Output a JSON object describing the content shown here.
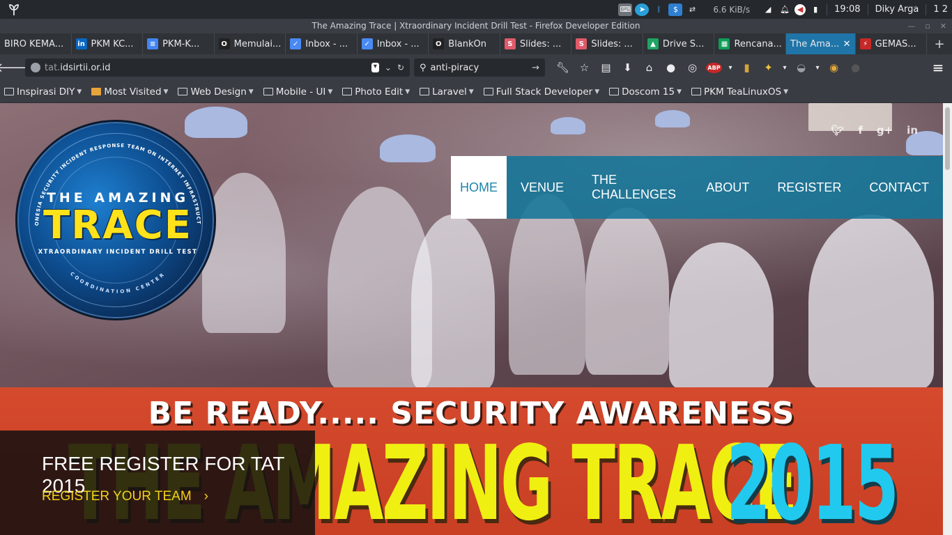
{
  "system": {
    "net_speed": "6.6 KiB/s",
    "clock": "19:08",
    "user": "Diky Arga",
    "workspaces": "1 2"
  },
  "window": {
    "title": "The Amazing Trace | Xtraordinary Incident Drill Test - Firefox Developer Edition"
  },
  "tabs": [
    {
      "label": "BIRO KEMA...",
      "icon": "none"
    },
    {
      "label": "PKM KC...",
      "icon": "linkedin-icon",
      "color": "#0a66c2",
      "glyph": "in"
    },
    {
      "label": "PKM-K...",
      "icon": "docs-icon",
      "color": "#4285f4",
      "glyph": "≡"
    },
    {
      "label": "Memulai...",
      "icon": "opera-icon",
      "color": "#222",
      "glyph": "O"
    },
    {
      "label": "Inbox - ...",
      "icon": "inbox-icon",
      "color": "#4a8af4",
      "glyph": "✓"
    },
    {
      "label": "Inbox - ...",
      "icon": "inbox-icon",
      "color": "#4a8af4",
      "glyph": "✓"
    },
    {
      "label": "BlankOn",
      "icon": "opera-icon",
      "color": "#222",
      "glyph": "O"
    },
    {
      "label": "Slides: ...",
      "icon": "slides-icon",
      "color": "#e05a6a",
      "glyph": "S"
    },
    {
      "label": "Slides: ...",
      "icon": "slides-icon",
      "color": "#e05a6a",
      "glyph": "S"
    },
    {
      "label": "Drive S...",
      "icon": "drive-icon",
      "color": "#1fa463",
      "glyph": "▲"
    },
    {
      "label": "Rencana...",
      "icon": "sheets-icon",
      "color": "#0f9d58",
      "glyph": "▦"
    },
    {
      "label": "The Ama...",
      "icon": "none",
      "active": true
    },
    {
      "label": "GEMAS...",
      "icon": "gemas-icon",
      "color": "#c62828",
      "glyph": "⚡"
    }
  ],
  "nav": {
    "url_dim": "tat.",
    "url_host": "idsirtii.or.id",
    "search_value": "anti-piracy"
  },
  "bookmarks": [
    {
      "label": "Inspirasi DIY"
    },
    {
      "label": "Most Visited",
      "special": true
    },
    {
      "label": "Web Design"
    },
    {
      "label": "Mobile - UI"
    },
    {
      "label": "Photo Edit"
    },
    {
      "label": "Laravel"
    },
    {
      "label": "Full Stack Developer"
    },
    {
      "label": "Doscom 15"
    },
    {
      "label": "PKM TeaLinuxOS"
    }
  ],
  "site": {
    "logo": {
      "top": "THE AMAZING",
      "main": "TRACE",
      "sub": "XTRAORDINARY INCIDENT DRILL TEST",
      "arc_top": "INDONESIA SECURITY INCIDENT RESPONSE TEAM ON INTERNET INFRASTRUCTURE",
      "arc_bottom": "COORDINATION CENTER"
    },
    "menu": [
      {
        "label": "HOME",
        "active": true
      },
      {
        "label": "VENUE"
      },
      {
        "label": "THE CHALLENGES"
      },
      {
        "label": "ABOUT"
      },
      {
        "label": "REGISTER"
      },
      {
        "label": "CONTACT"
      }
    ],
    "banner": {
      "line1": "BE READY.....  SECURITY AWARENESS",
      "line2": "THE AMAZING TRACE",
      "year": "2015"
    },
    "cta": {
      "title": "FREE REGISTER FOR TAT 2015",
      "link": "REGISTER YOUR TEAM",
      "arrow": "›"
    }
  }
}
